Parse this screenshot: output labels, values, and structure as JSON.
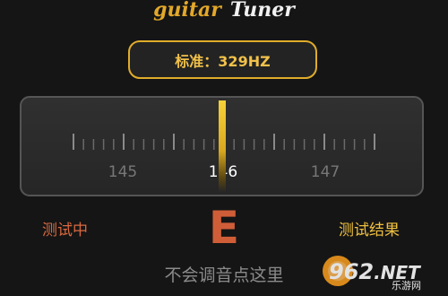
{
  "header": {
    "title_word1": "guitar",
    "title_word2": "Tuner"
  },
  "standard": {
    "label": "标准：329HZ"
  },
  "tuner": {
    "scale_labels": [
      "145",
      "146",
      "147"
    ],
    "current_value": "146",
    "needle_color": "#f2c83a"
  },
  "status": {
    "left_label": "测试中",
    "right_label": "测试结果",
    "note": "E"
  },
  "hint": {
    "text": "不会调音点这里"
  },
  "watermark": {
    "brand": "962.NET",
    "subtitle": "乐游网"
  },
  "colors": {
    "background": "#151515",
    "accent_gold": "#e0ac2a",
    "note_orange": "#cf5e38"
  }
}
